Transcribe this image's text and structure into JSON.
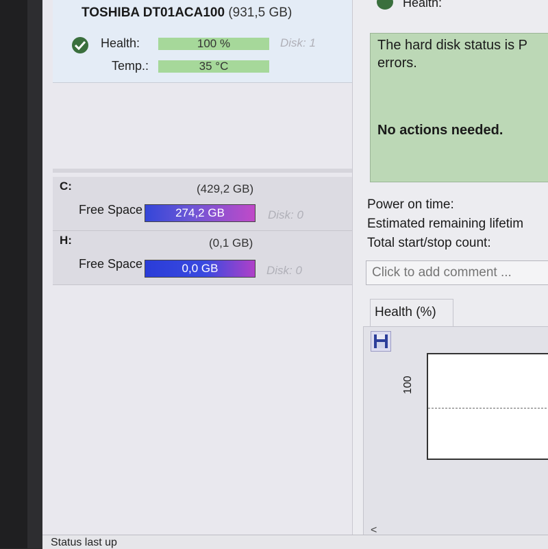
{
  "disk": {
    "model": "TOSHIBA DT01ACA100",
    "size": "(931,5 GB)",
    "health_label": "Health:",
    "health_value": "100 %",
    "temp_label": "Temp.:",
    "temp_value": "35 °C",
    "disk_index": "Disk: 1"
  },
  "volumes": [
    {
      "letter": "C:",
      "size": "(429,2 GB)",
      "free_label": "Free Space",
      "free_value": "274,2 GB",
      "disk_index": "Disk: 0"
    },
    {
      "letter": "H:",
      "size": "(0,1 GB)",
      "free_label": "Free Space",
      "free_value": "0,0 GB",
      "disk_index": "Disk: 0"
    }
  ],
  "right_pane": {
    "health_header": "Health:",
    "status_text": "The hard disk status is P\nerrors.",
    "status_strong": "No actions needed.",
    "power_on_time_label": "Power on time:",
    "remaining_lifetime_label": "Estimated remaining lifetim",
    "start_stop_label": "Total start/stop count:",
    "comment_placeholder": "Click to add comment ...",
    "graph_tab": "Health (%)",
    "graph_y_tick": "100",
    "scroll_left": "<"
  },
  "status_bar": {
    "text": "Status last up"
  },
  "colors": {
    "meter_green": "#a6d89a",
    "status_box_green": "#bcd8b6",
    "free_bar_blue": "#3446d8",
    "free_bar_magenta": "#c04ac8"
  },
  "icons": [
    "check-ok-icon",
    "save-icon"
  ]
}
